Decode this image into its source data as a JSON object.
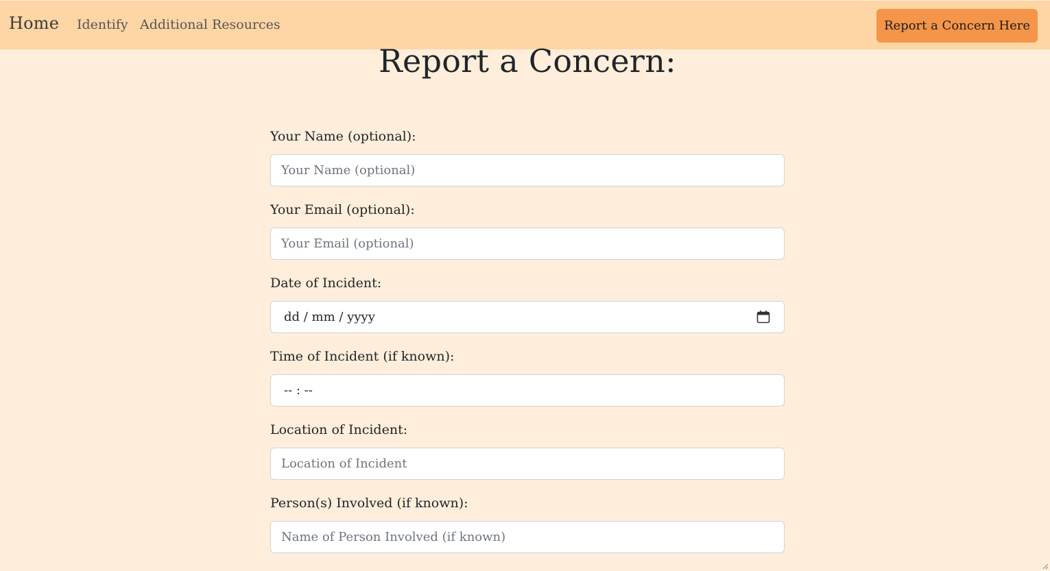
{
  "nav": {
    "brand": "Home",
    "links": [
      "Identify",
      "Additional Resources"
    ],
    "cta": "Report a Concern Here"
  },
  "page": {
    "title": "Report a Concern:"
  },
  "form": {
    "fields": [
      {
        "label": "Your Name (optional):",
        "placeholder": "Your Name (optional)",
        "value": ""
      },
      {
        "label": "Your Email (optional):",
        "placeholder": "Your Email (optional)",
        "value": ""
      },
      {
        "label": "Date of Incident:",
        "display": "dd / mm / yyyy",
        "icon": "calendar-icon"
      },
      {
        "label": "Time of Incident (if known):",
        "display": "-- : --"
      },
      {
        "label": "Location of Incident:",
        "placeholder": "Location of Incident",
        "value": ""
      },
      {
        "label": "Person(s) Involved (if known):",
        "placeholder": "Name of Person Involved (if known)",
        "value": ""
      }
    ]
  },
  "colors": {
    "page_background": "#ffeedb",
    "navbar_background": "#fed5a4",
    "cta_background": "#f4954a"
  }
}
